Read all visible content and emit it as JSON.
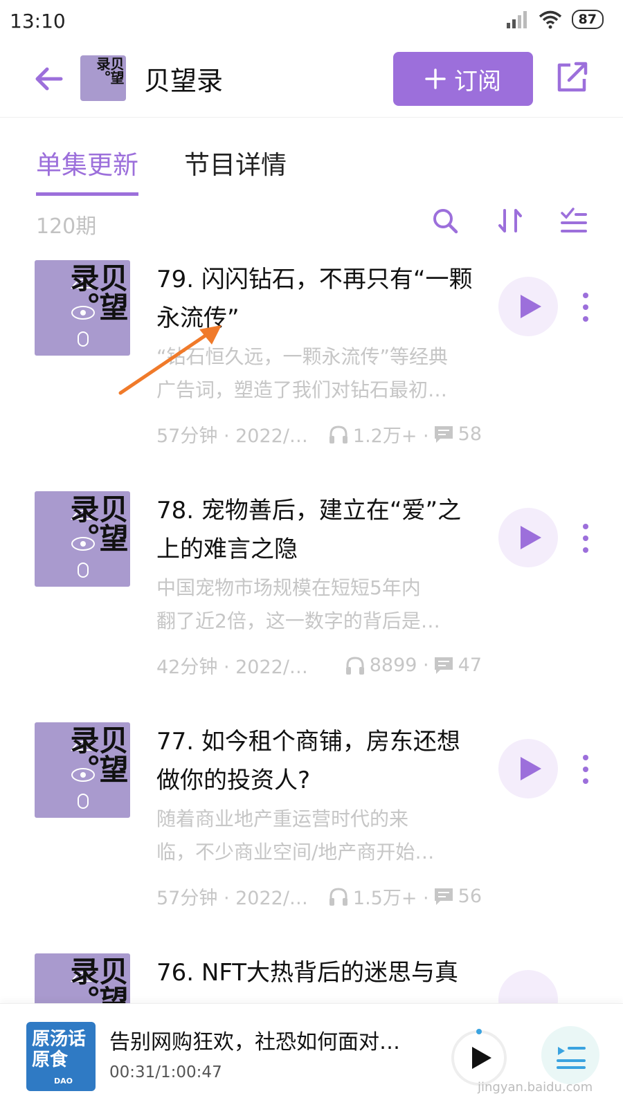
{
  "status": {
    "time": "13:10",
    "battery": "87"
  },
  "header": {
    "podcast_title": "贝望录",
    "thumb_text": "贝望录。",
    "subscribe_label": "订阅"
  },
  "tabs": [
    {
      "label": "单集更新",
      "active": true
    },
    {
      "label": "节目详情",
      "active": false
    }
  ],
  "toolbar": {
    "count": "120期"
  },
  "episodes": [
    {
      "title": "79. 闪闪钻石，不再只有“一颗永流传”",
      "desc_line1": "“钻石恒久远，一颗永流传”等经典",
      "desc_line2": "广告词，塑造了我们对钻石最初…",
      "duration_date": "57分钟 · 2022/…",
      "plays": "1.2万+ ·",
      "comments": "58"
    },
    {
      "title": "78. 宠物善后，建立在“爱”之上的难言之隐",
      "desc_line1": "中国宠物市场规模在短短5年内",
      "desc_line2": "翻了近2倍，这一数字的背后是…",
      "duration_date": "42分钟 · 2022/0…",
      "plays": "8899 ·",
      "comments": "47"
    },
    {
      "title": "77. 如今租个商铺，房东还想做你的投资人?",
      "desc_line1": "随着商业地产重运营时代的来",
      "desc_line2": "临，不少商业空间/地产商开始…",
      "duration_date": "57分钟 · 2022/…",
      "plays": "1.5万+ ·",
      "comments": "56"
    },
    {
      "title": "76. NFT大热背后的迷思与真",
      "desc_line1": "",
      "desc_line2": "",
      "duration_date": "",
      "plays": "",
      "comments": ""
    }
  ],
  "player": {
    "title": "告别网购狂欢，社恐如何面对…",
    "time": "00:31/1:00:47",
    "cover_text": "原汤话原食",
    "cover_small": "DAO"
  },
  "watermark": "jingyan.baidu.com",
  "colors": {
    "accent": "#9c6fdb",
    "cover": "#a99ace",
    "muted": "#c6c6c6"
  }
}
